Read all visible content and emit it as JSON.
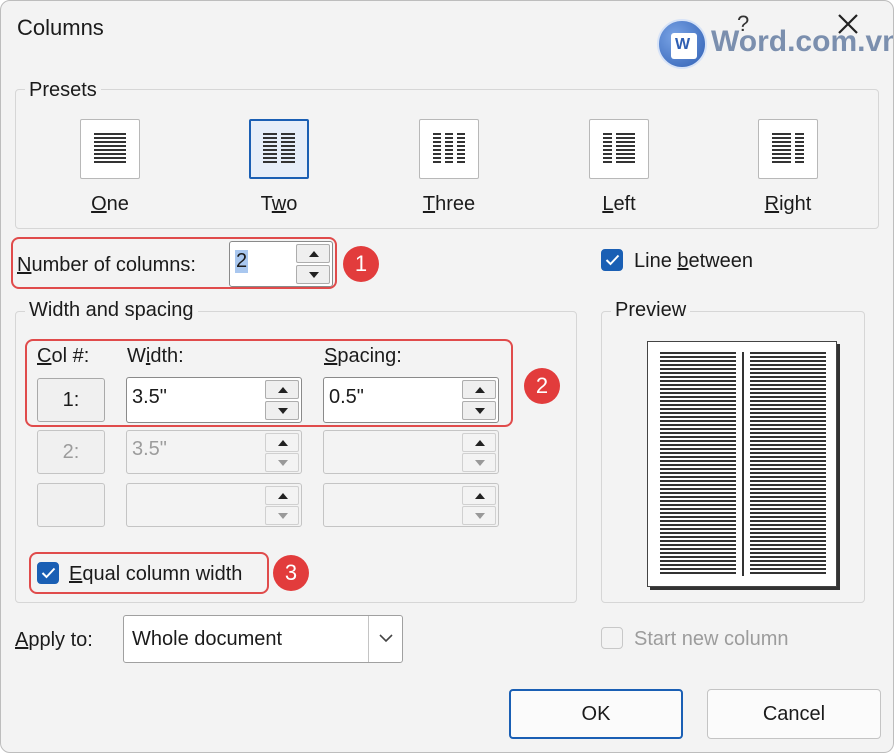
{
  "window": {
    "title": "Columns",
    "help_label": "?"
  },
  "watermark": {
    "text": "Word.com.vn",
    "doc_letter": "W"
  },
  "presets": {
    "label": "Presets",
    "items": [
      {
        "key": "one",
        "label_accel": "O",
        "label_rest": "ne",
        "selected": false
      },
      {
        "key": "two",
        "label_pre": "T",
        "label_accel": "w",
        "label_rest": "o",
        "selected": true
      },
      {
        "key": "three",
        "label_accel": "T",
        "label_rest": "hree",
        "selected": false
      },
      {
        "key": "left",
        "label_accel": "L",
        "label_rest": "eft",
        "selected": false
      },
      {
        "key": "right",
        "label_accel": "R",
        "label_rest": "ight",
        "selected": false
      }
    ]
  },
  "num_columns": {
    "label_accel": "N",
    "label_rest": "umber of columns:",
    "value": "2"
  },
  "line_between": {
    "label_pre": "Line ",
    "label_accel": "b",
    "label_rest": "etween",
    "checked": true
  },
  "width_spacing": {
    "label": "Width and spacing",
    "col_header_accel": "C",
    "col_header_rest": "ol #:",
    "width_header_pre": "W",
    "width_header_accel": "i",
    "width_header_rest": "dth:",
    "spacing_header_accel": "S",
    "spacing_header_rest": "pacing:",
    "rows": [
      {
        "col": "1:",
        "width": "3.5\"",
        "spacing": "0.5\"",
        "enabled": true
      },
      {
        "col": "2:",
        "width": "3.5\"",
        "spacing": "",
        "enabled": false
      },
      {
        "col": "",
        "width": "",
        "spacing": "",
        "enabled": false
      }
    ]
  },
  "equal_width": {
    "label_accel": "E",
    "label_rest": "qual column width",
    "checked": true
  },
  "preview": {
    "label": "Preview"
  },
  "apply_to": {
    "label_accel": "A",
    "label_rest": "pply to:",
    "value": "Whole document"
  },
  "start_new_column": {
    "label": "Start new column",
    "checked": false,
    "enabled": false
  },
  "buttons": {
    "ok": "OK",
    "cancel": "Cancel"
  },
  "badges": [
    "1",
    "2",
    "3"
  ],
  "colors": {
    "accent": "#1a5fb4",
    "highlight": "#e04b4b",
    "badge": "#e23c3c"
  }
}
